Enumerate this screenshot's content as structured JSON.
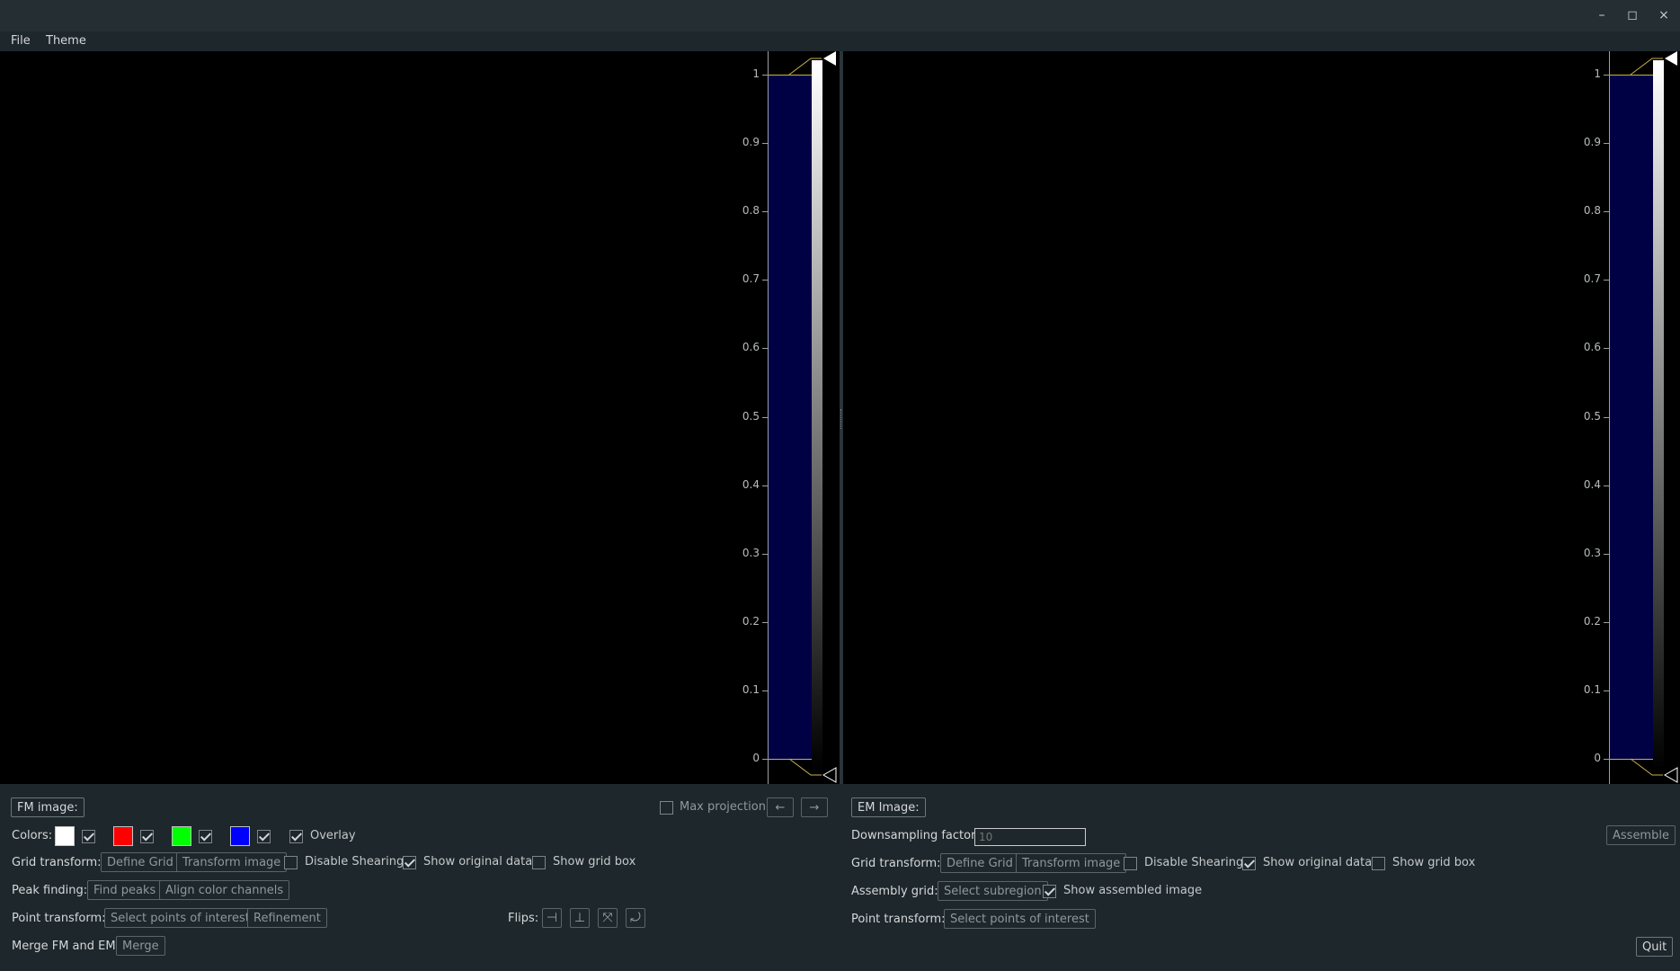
{
  "window": {
    "minimize": "–",
    "maximize": "◻",
    "close": "×"
  },
  "menu": {
    "file": "File",
    "theme": "Theme"
  },
  "histogram": {
    "ticks": [
      "1",
      "0.9",
      "0.8",
      "0.7",
      "0.6",
      "0.5",
      "0.4",
      "0.3",
      "0.2",
      "0.1",
      "0"
    ]
  },
  "fm": {
    "title_button": "FM image:",
    "max_projection": "Max projection",
    "prev": "←",
    "next": "→",
    "colors_label": "Colors:",
    "colors": [
      "#ffffff",
      "#ff0000",
      "#00ff00",
      "#0000ff"
    ],
    "overlay": "Overlay",
    "grid_transform_label": "Grid transform:",
    "define_grid": "Define Grid",
    "transform_image": "Transform image",
    "disable_shearing": "Disable Shearing",
    "show_original": "Show original data",
    "show_grid_box": "Show grid box",
    "peak_finding_label": "Peak finding:",
    "find_peaks": "Find peaks",
    "align_channels": "Align color channels",
    "point_transform_label": "Point transform:",
    "select_poi": "Select points of interest",
    "refinement": "Refinement",
    "flips_label": "Flips:",
    "merge_label": "Merge FM and EM:",
    "merge": "Merge"
  },
  "em": {
    "title_button": "EM Image:",
    "downsampling_label": "Downsampling factor:",
    "downsampling_placeholder": "10",
    "assemble": "Assemble",
    "grid_transform_label": "Grid transform:",
    "define_grid": "Define Grid",
    "transform_image": "Transform image",
    "disable_shearing": "Disable Shearing",
    "show_original": "Show original data",
    "show_grid_box": "Show grid box",
    "assembly_grid_label": "Assembly grid:",
    "select_subregion": "Select subregion",
    "show_assembled": "Show assembled image",
    "point_transform_label": "Point transform:",
    "select_poi": "Select points of interest",
    "quit": "Quit"
  }
}
